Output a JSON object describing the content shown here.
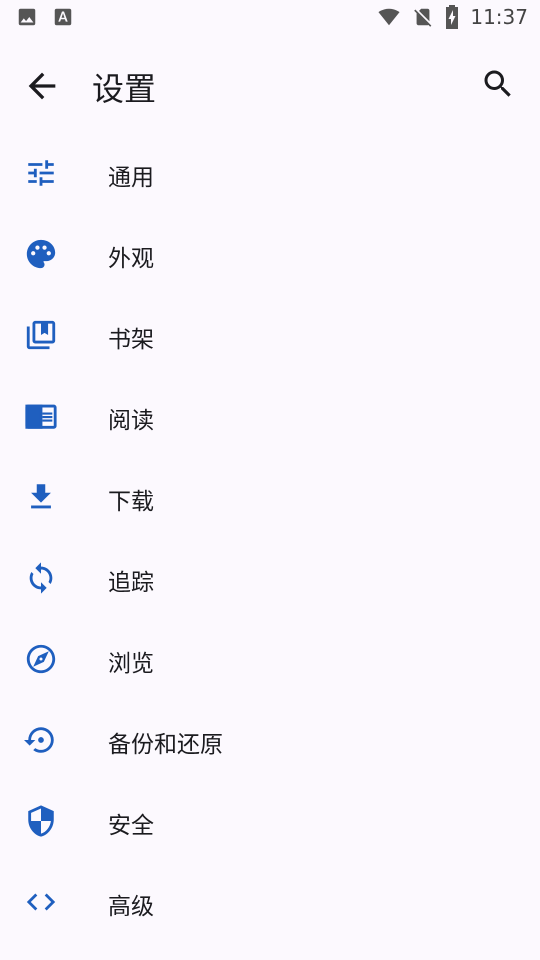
{
  "status_bar": {
    "time": "11:37",
    "left_icons": [
      "image-icon",
      "font-a-icon"
    ],
    "right_icons": [
      "wifi-icon",
      "no-sim-icon",
      "battery-charging-icon"
    ]
  },
  "app_bar": {
    "title": "设置",
    "back_icon": "arrow-back-icon",
    "search_icon": "search-icon"
  },
  "colors": {
    "accent": "#1f5fbf",
    "background": "#fcf9fe",
    "text": "#1b1b1f"
  },
  "menu": {
    "items": [
      {
        "label": "通用",
        "icon": "tune-icon"
      },
      {
        "label": "外观",
        "icon": "palette-icon"
      },
      {
        "label": "书架",
        "icon": "collections-bookmark-icon"
      },
      {
        "label": "阅读",
        "icon": "chrome-reader-icon"
      },
      {
        "label": "下载",
        "icon": "download-icon"
      },
      {
        "label": "追踪",
        "icon": "sync-icon"
      },
      {
        "label": "浏览",
        "icon": "explore-icon"
      },
      {
        "label": "备份和还原",
        "icon": "settings-backup-restore-icon"
      },
      {
        "label": "安全",
        "icon": "security-shield-icon"
      },
      {
        "label": "高级",
        "icon": "code-icon"
      }
    ]
  }
}
